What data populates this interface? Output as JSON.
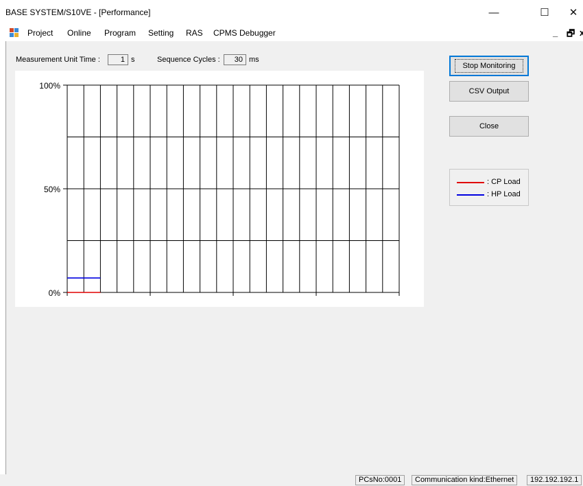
{
  "window": {
    "title": "BASE SYSTEM/S10VE - [Performance]",
    "minimize_glyph": "—",
    "maximize_glyph": "☐",
    "close_glyph": "✕"
  },
  "menu": {
    "items": [
      "Project",
      "Online",
      "Program",
      "Setting",
      "RAS",
      "CPMS Debugger"
    ],
    "mdi_minimize": "_",
    "mdi_restore": "🗗",
    "mdi_close": "x"
  },
  "params": {
    "unit_time_label": "Measurement Unit Time :",
    "unit_time_value": "1",
    "unit_time_unit": "s",
    "cycles_label": "Sequence Cycles :",
    "cycles_value": "30",
    "cycles_unit": "ms"
  },
  "buttons": {
    "stop": "Stop Monitoring",
    "csv": "CSV Output",
    "close": "Close"
  },
  "legend": [
    {
      "label": ": CP Load",
      "color": "#e00000"
    },
    {
      "label": ": HP Load",
      "color": "#0000e0"
    }
  ],
  "chart_data": {
    "type": "line",
    "y_tick_labels": [
      "100%",
      "50%",
      "0%"
    ],
    "ylim": [
      0,
      100
    ],
    "x_divisions": 20,
    "y_divisions": 4,
    "grid": true,
    "series": [
      {
        "name": "CP Load",
        "color": "#e00000",
        "x": [
          0,
          1,
          2
        ],
        "values": [
          0,
          0,
          0
        ]
      },
      {
        "name": "HP Load",
        "color": "#0000e0",
        "x": [
          0,
          1,
          2
        ],
        "values": [
          7,
          7,
          7
        ]
      }
    ]
  },
  "status": {
    "pcs_no": "PCsNo:0001",
    "comm_kind": "Communication kind:Ethernet",
    "ip": "192.192.192.1"
  }
}
